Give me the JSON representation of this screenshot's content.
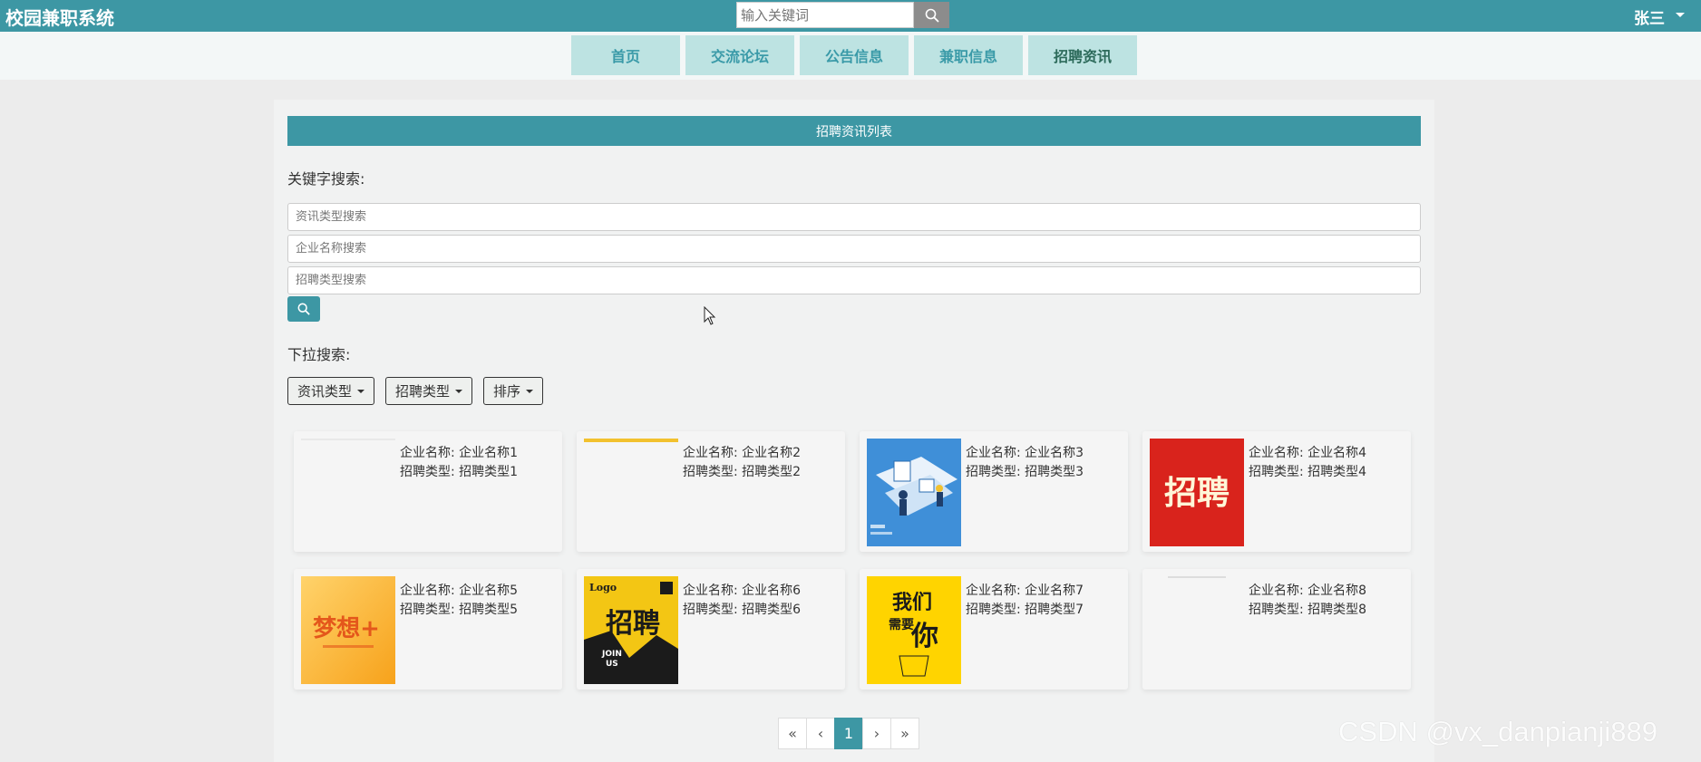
{
  "app": {
    "title": "校园兼职系统"
  },
  "top_search": {
    "placeholder": "输入关键词"
  },
  "user": {
    "name": "张三"
  },
  "nav": {
    "items": [
      {
        "label": "首页"
      },
      {
        "label": "交流论坛"
      },
      {
        "label": "公告信息"
      },
      {
        "label": "兼职信息"
      },
      {
        "label": "招聘资讯"
      }
    ],
    "active": "招聘资讯"
  },
  "panel": {
    "title": "招聘资讯列表",
    "keyword_label": "关键字搜索:",
    "fields": [
      {
        "placeholder": "资讯类型搜索"
      },
      {
        "placeholder": "企业名称搜索"
      },
      {
        "placeholder": "招聘类型搜索"
      }
    ],
    "dropdown_label": "下拉搜索:",
    "dropdowns": [
      {
        "label": "资讯类型"
      },
      {
        "label": "招聘类型"
      },
      {
        "label": "排序"
      }
    ]
  },
  "cards": [
    {
      "company_label": "企业名称:",
      "company": "企业名称1",
      "type_label": "招聘类型:",
      "type": "招聘类型1",
      "image": "blank"
    },
    {
      "company_label": "企业名称:",
      "company": "企业名称2",
      "type_label": "招聘类型:",
      "type": "招聘类型2",
      "image": "blank-yellow-bar"
    },
    {
      "company_label": "企业名称:",
      "company": "企业名称3",
      "type_label": "招聘类型:",
      "type": "招聘类型3",
      "image": "office-illustration"
    },
    {
      "company_label": "企业名称:",
      "company": "企业名称4",
      "type_label": "招聘类型:",
      "type": "招聘类型4",
      "image": "red-recruit-poster"
    },
    {
      "company_label": "企业名称:",
      "company": "企业名称5",
      "type_label": "招聘类型:",
      "type": "招聘类型5",
      "image": "dream-poster"
    },
    {
      "company_label": "企业名称:",
      "company": "企业名称6",
      "type_label": "招聘类型:",
      "type": "招聘类型6",
      "image": "black-yellow-recruit-poster"
    },
    {
      "company_label": "企业名称:",
      "company": "企业名称7",
      "type_label": "招聘类型:",
      "type": "招聘类型7",
      "image": "we-need-you-poster"
    },
    {
      "company_label": "企业名称:",
      "company": "企业名称8",
      "type_label": "招聘类型:",
      "type": "招聘类型8",
      "image": "blank"
    }
  ],
  "poster_text": {
    "p4": "招聘",
    "p5": "梦想+",
    "p6_logo": "Logo",
    "p6_main": "招聘",
    "p6_join": "JOIN",
    "p6_us": "US",
    "p7_a": "我们",
    "p7_b": "需要",
    "p7_c": "你"
  },
  "pagination": {
    "first": "«",
    "prev": "‹",
    "current": "1",
    "next": "›",
    "last": "»"
  },
  "watermark": "CSDN @vx_danpianji889",
  "colors": {
    "primary": "#3d97a4",
    "nav_bg": "#bde3e2"
  }
}
